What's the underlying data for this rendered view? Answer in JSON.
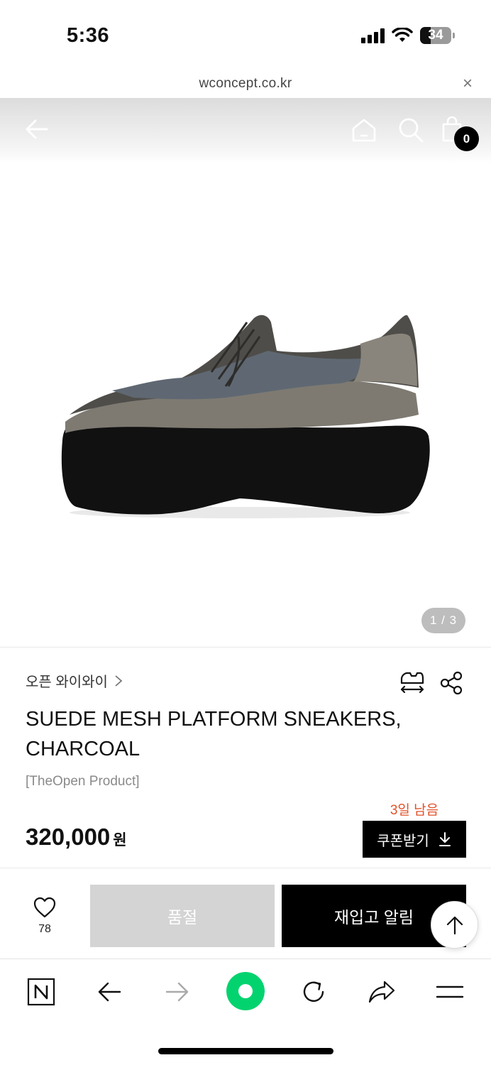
{
  "status_bar": {
    "time": "5:36",
    "battery": "34",
    "icons": [
      "signal-icon",
      "wifi-icon",
      "battery-icon"
    ]
  },
  "url_bar": {
    "url": "wconcept.co.kr",
    "close_icon": "×"
  },
  "header": {
    "cart_count": "0",
    "icons": [
      "back-arrow-icon",
      "home-icon",
      "search-icon",
      "shopping-bag-icon"
    ]
  },
  "gallery": {
    "counter": "1 / 3"
  },
  "product": {
    "brand": "오픈 와이와이",
    "title": "SUEDE MESH PLATFORM SNEAKERS, CHARCOAL",
    "subtitle": "[TheOpen Product]",
    "price": "320,000",
    "price_unit": "원"
  },
  "coupon": {
    "remaining": "3일 남음",
    "label": "쿠폰받기"
  },
  "actions": {
    "like_count": "78",
    "soldout_label": "품절",
    "restock_label": "재입고 알림"
  },
  "browser_toolbar": {
    "icons": [
      "naver-n-icon",
      "back-icon",
      "forward-icon",
      "green-home-icon",
      "reload-icon",
      "share-icon",
      "menu-icon"
    ]
  },
  "colors": {
    "accent": "#e2512a",
    "primary": "#000000",
    "disabled": "#d4d4d4",
    "naver_green": "#03d36f"
  }
}
